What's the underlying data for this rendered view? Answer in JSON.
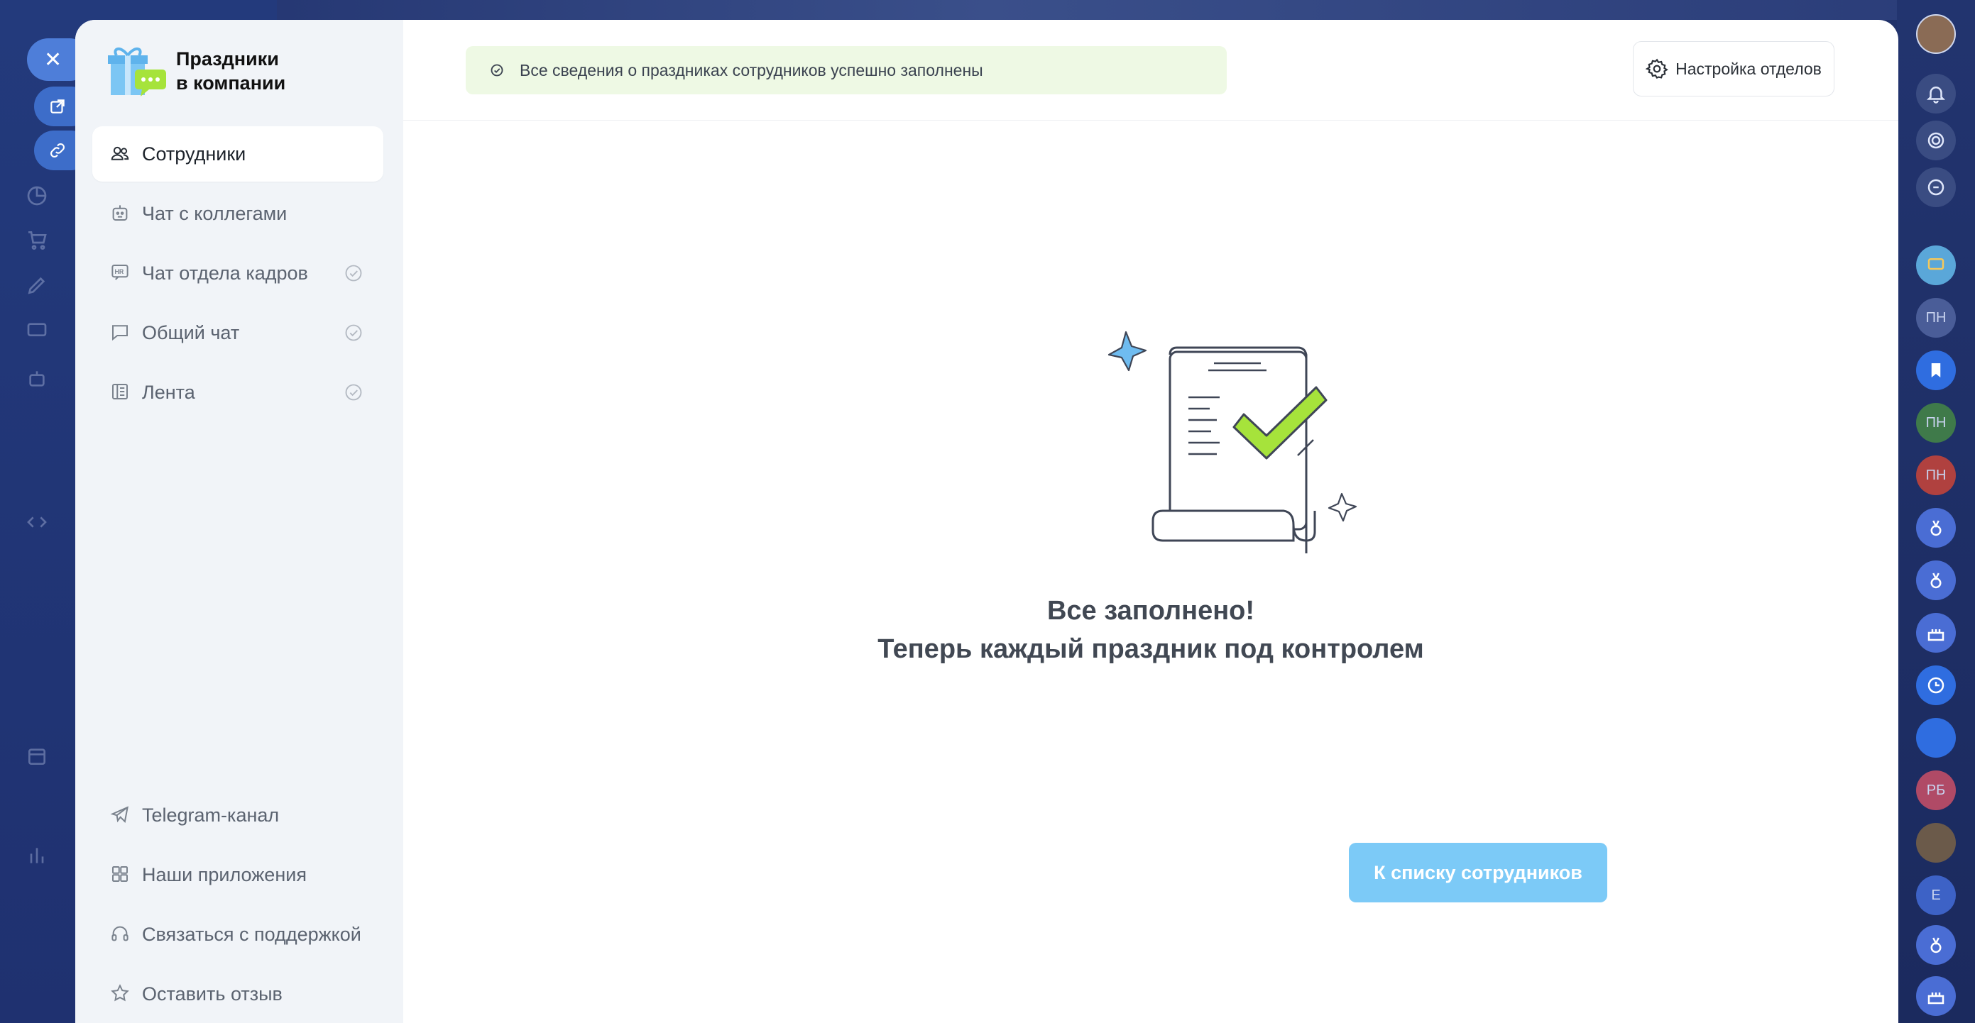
{
  "app": {
    "logo_line1": "Праздники",
    "logo_line2": "в компании"
  },
  "sidebar": {
    "items": [
      {
        "label": "Сотрудники",
        "icon": "users-icon",
        "active": true,
        "checked": false
      },
      {
        "label": "Чат с коллегами",
        "icon": "robot-icon",
        "active": false,
        "checked": false
      },
      {
        "label": "Чат отдела кадров",
        "icon": "hr-chat-icon",
        "active": false,
        "checked": true
      },
      {
        "label": "Общий чат",
        "icon": "chat-bubble-icon",
        "active": false,
        "checked": true
      },
      {
        "label": "Лента",
        "icon": "feed-icon",
        "active": false,
        "checked": true
      }
    ],
    "bottom_items": [
      {
        "label": "Telegram-канал",
        "icon": "telegram-icon"
      },
      {
        "label": "Наши приложения",
        "icon": "apps-grid-icon"
      },
      {
        "label": "Связаться с поддержкой",
        "icon": "headset-icon"
      },
      {
        "label": "Оставить отзыв",
        "icon": "star-icon"
      }
    ]
  },
  "topbar": {
    "banner_text": "Все сведения о праздниках сотрудников успешно заполнены",
    "settings_label": "Настройка отделов"
  },
  "main": {
    "headline_line1": "Все заполнено!",
    "headline_line2": "Теперь каждый праздник под контролем",
    "cta_label": "К списку сотрудников"
  },
  "right_rail": {
    "badges": [
      "ПН",
      "ПН",
      "ПН",
      "РБ",
      "Е"
    ]
  },
  "colors": {
    "accent": "#7ccaf7",
    "banner_bg": "#eef9e4",
    "check_green": "#a6e33b",
    "sidebar_bg": "#f1f4f8"
  }
}
